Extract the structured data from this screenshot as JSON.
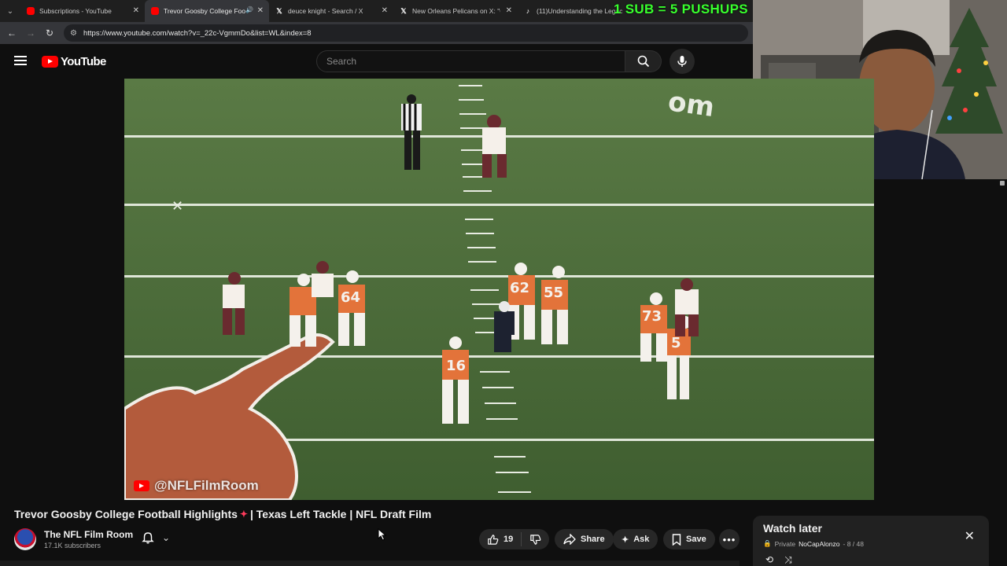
{
  "browser": {
    "tabs": [
      {
        "icon": "youtube-icon",
        "title": "Subscriptions - YouTube",
        "active": false
      },
      {
        "icon": "youtube-icon",
        "title": "Trevor Goosby College Foo",
        "active": true
      },
      {
        "icon": "x-icon",
        "title": "deuce knight - Search / X",
        "active": false
      },
      {
        "icon": "x-icon",
        "title": "New Orleans Pelicans on X: \"C",
        "active": false
      },
      {
        "icon": "tiktok-icon",
        "title": "(11)Understanding the Legac",
        "active": false
      }
    ],
    "url": "https://www.youtube.com/watch?v=_22c-VgmmDo&list=WL&index=8"
  },
  "overlay": {
    "promo_text": "1 SUB = 5 PUSHUPS"
  },
  "youtube": {
    "logo_text": "YouTube",
    "search_placeholder": "Search"
  },
  "video": {
    "watermark": "@NFLFilmRoom",
    "title_part1": "Trevor Goosby College Football Highlights",
    "title_part2": "| Texas Left Tackle | NFL Draft Film",
    "jersey_numbers": [
      "16",
      "73",
      "5",
      "62",
      "55",
      "64"
    ]
  },
  "channel": {
    "name": "The NFL Film Room",
    "subscribers": "17.1K subscribers"
  },
  "actions": {
    "likes": "19",
    "share": "Share",
    "ask": "Ask",
    "save": "Save"
  },
  "watch_later": {
    "title": "Watch later",
    "privacy": "Private",
    "owner": "NoCapAlonzo",
    "position": "- 8 / 48"
  },
  "colors": {
    "accent": "#ff0000",
    "promo": "#39ff2e",
    "field": "#4c6c3a",
    "texas_orange": "#e3733a"
  }
}
